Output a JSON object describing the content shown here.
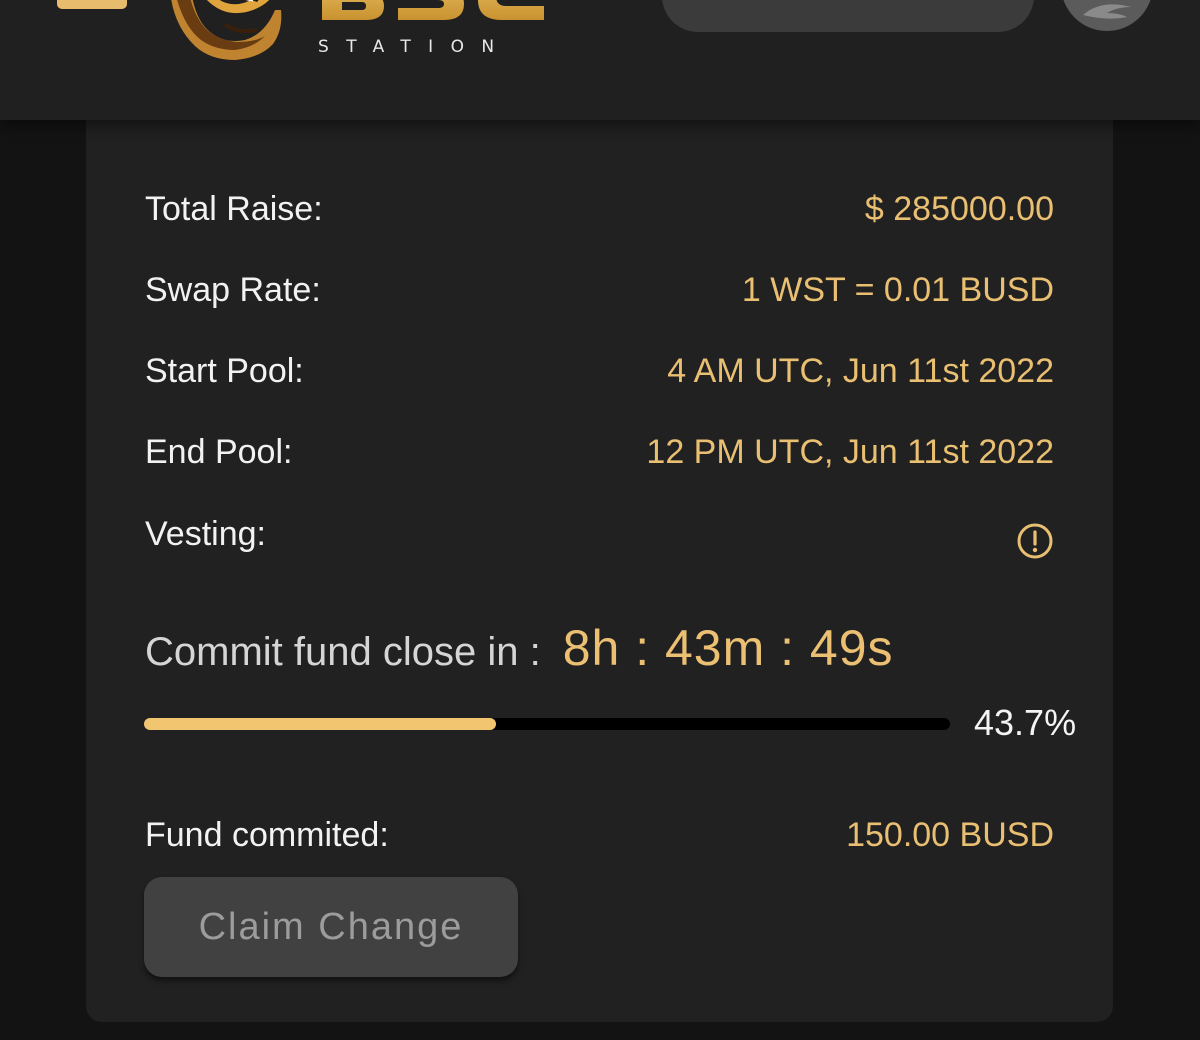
{
  "header": {
    "logo_subtitle": "STATION",
    "colors": {
      "accent": "#e9bf72",
      "background": "#131313",
      "card": "#222122"
    }
  },
  "pool": {
    "rows": [
      {
        "label": "Total Raise:",
        "value": "$ 285000.00"
      },
      {
        "label": "Swap Rate:",
        "value": "1 WST = 0.01 BUSD"
      },
      {
        "label": "Start Pool:",
        "value": "4 AM UTC, Jun 11st 2022"
      },
      {
        "label": "End Pool:",
        "value": "12 PM UTC, Jun 11st 2022"
      }
    ],
    "vesting_label": "Vesting:",
    "vesting_icon": "info-circle-icon"
  },
  "countdown": {
    "label": "Commit fund close in :",
    "time": "8h : 43m : 49s"
  },
  "progress": {
    "percent": 43.7,
    "text": "43.7%"
  },
  "fund": {
    "label": "Fund commited:",
    "value": "150.00 BUSD"
  },
  "claim_button": {
    "label": "Claim Change"
  }
}
